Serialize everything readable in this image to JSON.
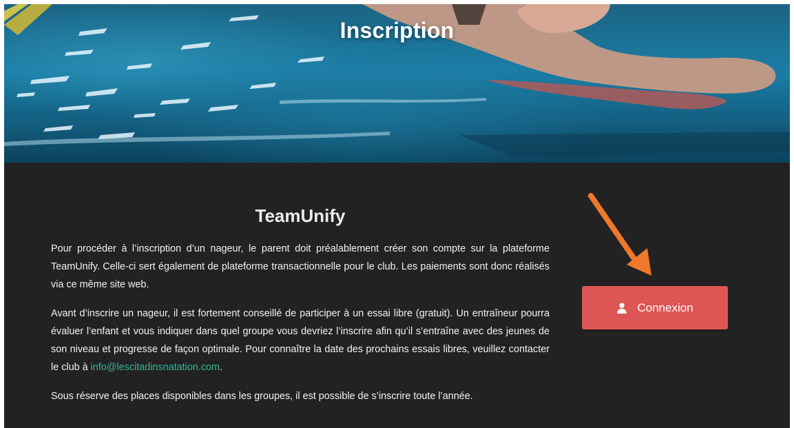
{
  "hero": {
    "title": "Inscription"
  },
  "main": {
    "section_title": "TeamUnify",
    "paragraphs": [
      {
        "text": "Pour procéder à l’inscription d’un nageur, le parent doit préalablement créer son compte sur la plateforme TeamUnify. Celle-ci sert également de plateforme transactionnelle pour le club. Les paiements sont donc réalisés via ce même site web."
      },
      {
        "text_before_link": "Avant d’inscrire un nageur, il est fortement conseillé de participer à un essai libre (gratuit). Un entraîneur pourra évaluer l’enfant et vous indiquer dans quel groupe vous devriez l’inscrire afin qu’il s’entraîne avec des jeunes de son niveau et progresse de façon optimale. Pour connaître la date des prochains essais libres, veuillez contacter le club à ",
        "link_text": "info@lescitadinsnatation.com",
        "text_after_link": "."
      },
      {
        "text": "Sous réserve des places disponibles dans les groupes, il est possible de s’inscrire toute l’année."
      }
    ]
  },
  "login_button": {
    "label": "Connexion",
    "icon": "user-icon"
  },
  "colors": {
    "background": "#222222",
    "button": "#dd5554",
    "link": "#35b59a",
    "arrow": "#f0782a"
  }
}
